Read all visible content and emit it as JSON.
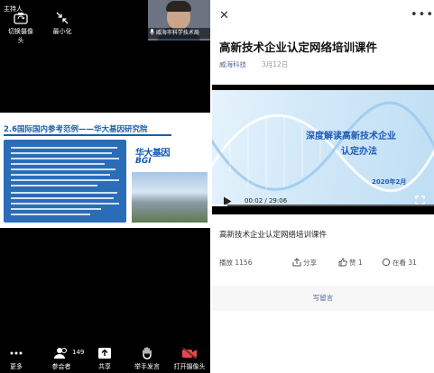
{
  "meeting": {
    "host_label": "主持人",
    "toolbar_top": [
      {
        "label": "切换摄像头",
        "icon": "camera-switch-icon"
      },
      {
        "label": "最小化",
        "icon": "minimize-icon"
      }
    ],
    "self_view_name": "威海市科学技术局",
    "slide": {
      "title": "2.6国际国内参考范例——华大基因研究院",
      "logo_cn": "华大基因",
      "logo_en": "BGI"
    },
    "toolbar_bottom": [
      {
        "label": "更多",
        "icon": "more-dots-icon"
      },
      {
        "label": "参会者",
        "icon": "participants-icon",
        "count": "149"
      },
      {
        "label": "共享",
        "icon": "share-screen-icon"
      },
      {
        "label": "举手发言",
        "icon": "raise-hand-icon"
      },
      {
        "label": "打开摄像头",
        "icon": "camera-off-icon",
        "color": "#e5484d"
      }
    ]
  },
  "article": {
    "close_icon": "close-icon",
    "more_icon": "more-dots-icon",
    "title": "高新技术企业认定网络培训课件",
    "account": "威海科技",
    "date": "3月12日",
    "video": {
      "title_line1": "深度解读高新技术企业",
      "title_line2": "认定办法",
      "date_text": "2020年2月",
      "time": "00:02 / 29:06",
      "progress_percent": 7
    },
    "caption": "高新技术企业认定网络培训课件",
    "stats": {
      "views_label": "播放",
      "views": "1156",
      "share": "分享",
      "like": "赞 1",
      "watching": "在看 31"
    },
    "comment_label": "写留言",
    "colors": {
      "link": "#576b95",
      "video_title": "#1e5ab8"
    }
  }
}
